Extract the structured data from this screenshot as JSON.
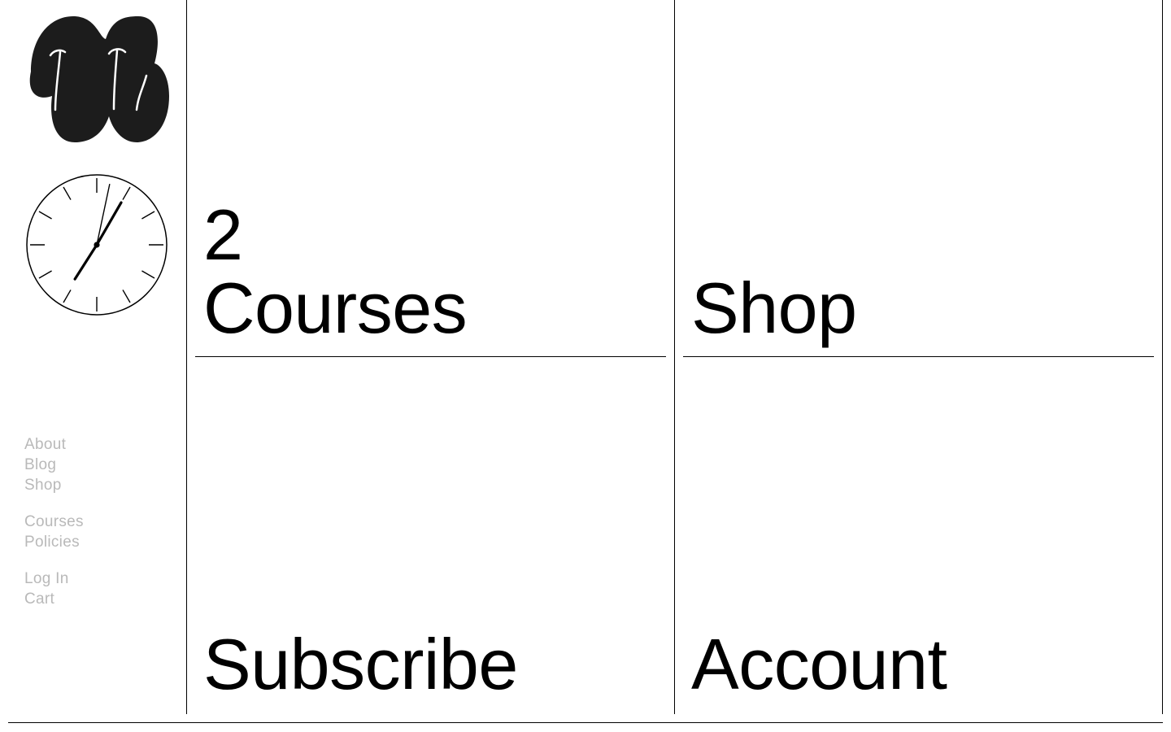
{
  "sidebar": {
    "logo_icon": "squiggle-logo-icon",
    "clock_icon": "analog-clock-icon",
    "clock": {
      "hours": 7,
      "minutes": 5,
      "seconds": 2
    },
    "nav_groups": [
      [
        "About",
        "Blog",
        "Shop"
      ],
      [
        "Courses",
        "Policies"
      ],
      [
        "Log In",
        "Cart"
      ]
    ],
    "nav_color": "#b9b9b9"
  },
  "tiles": {
    "courses": {
      "count": "2",
      "label": "Courses"
    },
    "shop": {
      "label": "Shop"
    },
    "subscribe": {
      "label": "Subscribe"
    },
    "account": {
      "label": "Account"
    }
  }
}
